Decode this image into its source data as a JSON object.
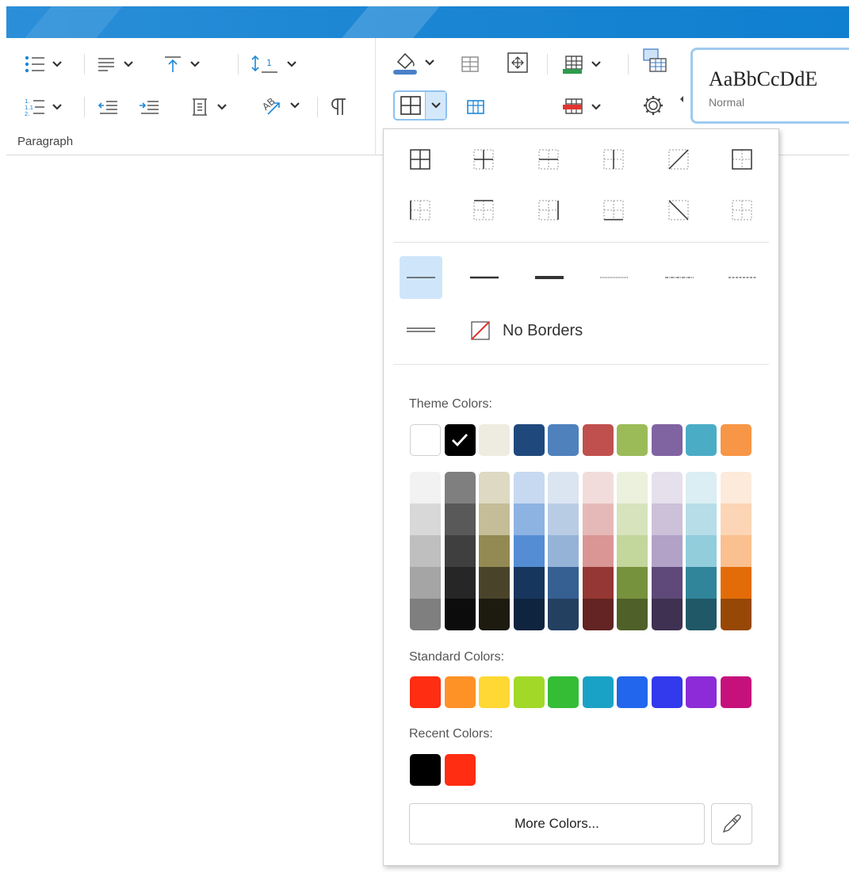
{
  "ribbon": {
    "paragraph_group_label": "Paragraph",
    "icons": [
      "bullet-list-icon",
      "numbered-list-icon",
      "align-icon",
      "indent-decrease-icon",
      "indent-increase-icon",
      "vertical-align-top-icon",
      "line-spacing-icon",
      "text-direction-icon",
      "paragraph-mark-icon",
      "shading-fill-icon",
      "table-borders-icon",
      "table-insert-icon",
      "gear-icon"
    ]
  },
  "style_gallery": {
    "sample_text": "AaBbCcDdE",
    "style_name": "Normal"
  },
  "borders_dropdown": {
    "no_borders_label": "No Borders",
    "theme_colors_label": "Theme Colors:",
    "standard_colors_label": "Standard Colors:",
    "recent_colors_label": "Recent Colors:",
    "more_colors_label": "More Colors...",
    "selected_line_style": "thin-solid",
    "selected_theme_color": "#000000",
    "theme_colors": [
      "#FFFFFF",
      "#000000",
      "#EEECE1",
      "#1F497D",
      "#4F81BD",
      "#C0504D",
      "#9BBB59",
      "#8064A2",
      "#4BACC6",
      "#F79646"
    ],
    "theme_shades": [
      [
        "#F2F2F2",
        "#D8D8D8",
        "#BFBFBF",
        "#A5A5A5",
        "#7F7F7F"
      ],
      [
        "#7F7F7F",
        "#595959",
        "#3F3F3F",
        "#262626",
        "#0C0C0C"
      ],
      [
        "#DDD9C3",
        "#C4BD97",
        "#938953",
        "#494429",
        "#1D1B10"
      ],
      [
        "#C6D9F0",
        "#8DB3E2",
        "#548DD4",
        "#17365D",
        "#0F243E"
      ],
      [
        "#DBE5F1",
        "#B8CCE4",
        "#95B3D7",
        "#366092",
        "#244061"
      ],
      [
        "#F2DCDB",
        "#E5B9B7",
        "#D99694",
        "#953734",
        "#632423"
      ],
      [
        "#EBF1DD",
        "#D7E3BC",
        "#C3D69B",
        "#76923C",
        "#4F6128"
      ],
      [
        "#E5E0EC",
        "#CCC1D9",
        "#B2A2C7",
        "#5F497A",
        "#3F3151"
      ],
      [
        "#DBEEF3",
        "#B7DDE8",
        "#92CDDC",
        "#31859B",
        "#205867"
      ],
      [
        "#FDEADA",
        "#FBD5B5",
        "#FAC08F",
        "#E36C09",
        "#974806"
      ]
    ],
    "standard_colors": [
      "#FF2D12",
      "#FF9226",
      "#FFD834",
      "#A2D928",
      "#34BD35",
      "#19A2C6",
      "#2166EC",
      "#3339EC",
      "#8C2BD7",
      "#C6107C"
    ],
    "recent_colors": [
      "#000000",
      "#FF2D12"
    ]
  }
}
